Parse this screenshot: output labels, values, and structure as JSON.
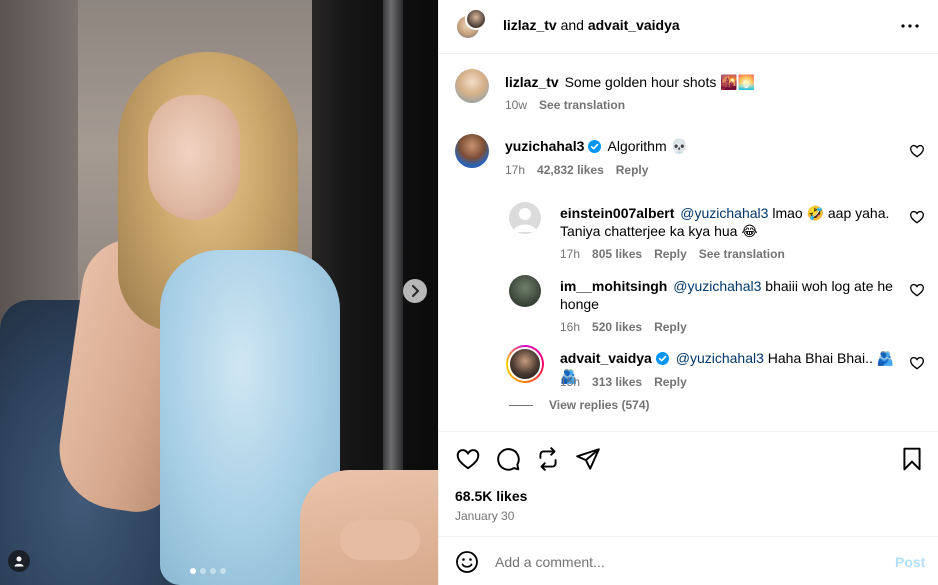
{
  "header": {
    "user1": "lizlaz_tv",
    "connector": "and",
    "user2": "advait_vaidya"
  },
  "caption": {
    "username": "lizlaz_tv",
    "text": "Some golden hour shots 🌇🌅",
    "time": "10w",
    "see_translation": "See translation"
  },
  "comments": [
    {
      "username": "yuzichahal3",
      "verified": true,
      "text": "Algorithm 💀",
      "time": "17h",
      "likes": "42,832 likes",
      "reply": "Reply"
    },
    {
      "username": "einstein007albert",
      "mention": "@yuzichahal3",
      "text_line1": "lmao 🤣 aap yaha.",
      "text_line2": "Taniya chatterjee ka kya hua 😂",
      "time": "17h",
      "likes": "805 likes",
      "reply": "Reply",
      "see_translation": "See translation"
    },
    {
      "username": "im__mohitsingh",
      "mention": "@yuzichahal3",
      "text_line1": "bhaiii woh log ate he",
      "text_line2": "honge",
      "time": "16h",
      "likes": "520 likes",
      "reply": "Reply"
    },
    {
      "username": "advait_vaidya",
      "verified": true,
      "mention": "@yuzichahal3",
      "text": "Haha Bhai Bhai.. 🫂🫂",
      "time": "15h",
      "likes": "313 likes",
      "reply": "Reply"
    }
  ],
  "view_replies": "View replies (574)",
  "post": {
    "likes": "68.5K likes",
    "date": "January 30"
  },
  "add_comment": {
    "placeholder": "Add a comment...",
    "post_label": "Post"
  },
  "colors": {
    "verified_blue": "#0095f6",
    "mention_blue": "#00376b",
    "post_button_disabled": "#b2dffc",
    "meta_gray": "#737373"
  },
  "icons": [
    "more-icon",
    "heart-icon",
    "comment-icon",
    "repost-icon",
    "share-icon",
    "bookmark-icon",
    "emoji-icon",
    "chevron-right-icon",
    "user-tag-icon",
    "verified-icon"
  ],
  "carousel": {
    "total": 4,
    "active": 1
  }
}
